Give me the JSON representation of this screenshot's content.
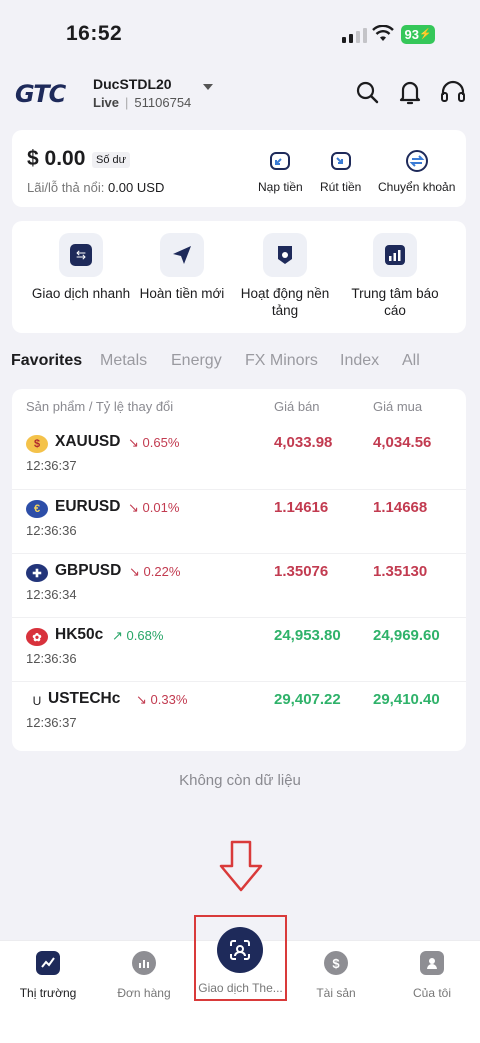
{
  "status_bar": {
    "time": "16:52",
    "battery": "93"
  },
  "header": {
    "logo": "GTC",
    "account_name": "DucSTDL20",
    "account_type": "Live",
    "account_id": "51106754",
    "icons": [
      "search-icon",
      "bell-icon",
      "headset-icon"
    ]
  },
  "balance": {
    "amount": "$ 0.00",
    "badge": "Số dư",
    "pnl_label": "Lãi/lỗ thả nổi:",
    "pnl_value": "0.00",
    "pnl_currency": "USD",
    "actions": [
      {
        "label": "Nạp tiền",
        "icon": "deposit-icon"
      },
      {
        "label": "Rút tiền",
        "icon": "withdraw-icon"
      },
      {
        "label": "Chuyển khoản",
        "icon": "transfer-icon"
      }
    ]
  },
  "quick_actions": [
    {
      "label": "Giao dịch nhanh",
      "icon": "quick-trade-icon"
    },
    {
      "label": "Hoàn tiền mới",
      "icon": "paper-plane-icon"
    },
    {
      "label": "Hoạt động nền tảng",
      "icon": "shield-badge-icon"
    },
    {
      "label": "Trung tâm báo cáo",
      "icon": "report-chart-icon"
    }
  ],
  "tabs": [
    "Favorites",
    "Metals",
    "Energy",
    "FX Minors",
    "Index",
    "All"
  ],
  "market": {
    "col_product": "Sản phẩm / Tỷ lệ thay đổi",
    "col_bid": "Giá bán",
    "col_ask": "Giá mua",
    "rows": [
      {
        "symbol": "XAUUSD",
        "change": "0.65%",
        "direction": "down",
        "time": "12:36:37",
        "bid": "4,033.98",
        "ask": "4,034.56",
        "color": "red"
      },
      {
        "symbol": "EURUSD",
        "change": "0.01%",
        "direction": "down",
        "time": "12:36:36",
        "bid": "1.14616",
        "ask": "1.14668",
        "color": "red"
      },
      {
        "symbol": "GBPUSD",
        "change": "0.22%",
        "direction": "down",
        "time": "12:36:34",
        "bid": "1.35076",
        "ask": "1.35130",
        "color": "red"
      },
      {
        "symbol": "HK50c",
        "change": "0.68%",
        "direction": "up",
        "time": "12:36:36",
        "bid": "24,953.80",
        "ask": "24,969.60",
        "color": "green"
      },
      {
        "symbol": "USTECHc",
        "change": "0.33%",
        "direction": "down",
        "time": "12:36:37",
        "bid": "29,407.22",
        "ask": "29,410.40",
        "color": "green",
        "flag_text": "U"
      }
    ]
  },
  "no_more_data": "Không còn dữ liệu",
  "bottom_nav": [
    {
      "label": "Thị trường",
      "icon": "market-chart-icon",
      "active": true
    },
    {
      "label": "Đơn hàng",
      "icon": "orders-icon"
    },
    {
      "label": "Giao dịch The...",
      "icon": "copy-trade-icon"
    },
    {
      "label": "Tài sản",
      "icon": "assets-dollar-icon"
    },
    {
      "label": "Của tôi",
      "icon": "profile-icon"
    }
  ]
}
